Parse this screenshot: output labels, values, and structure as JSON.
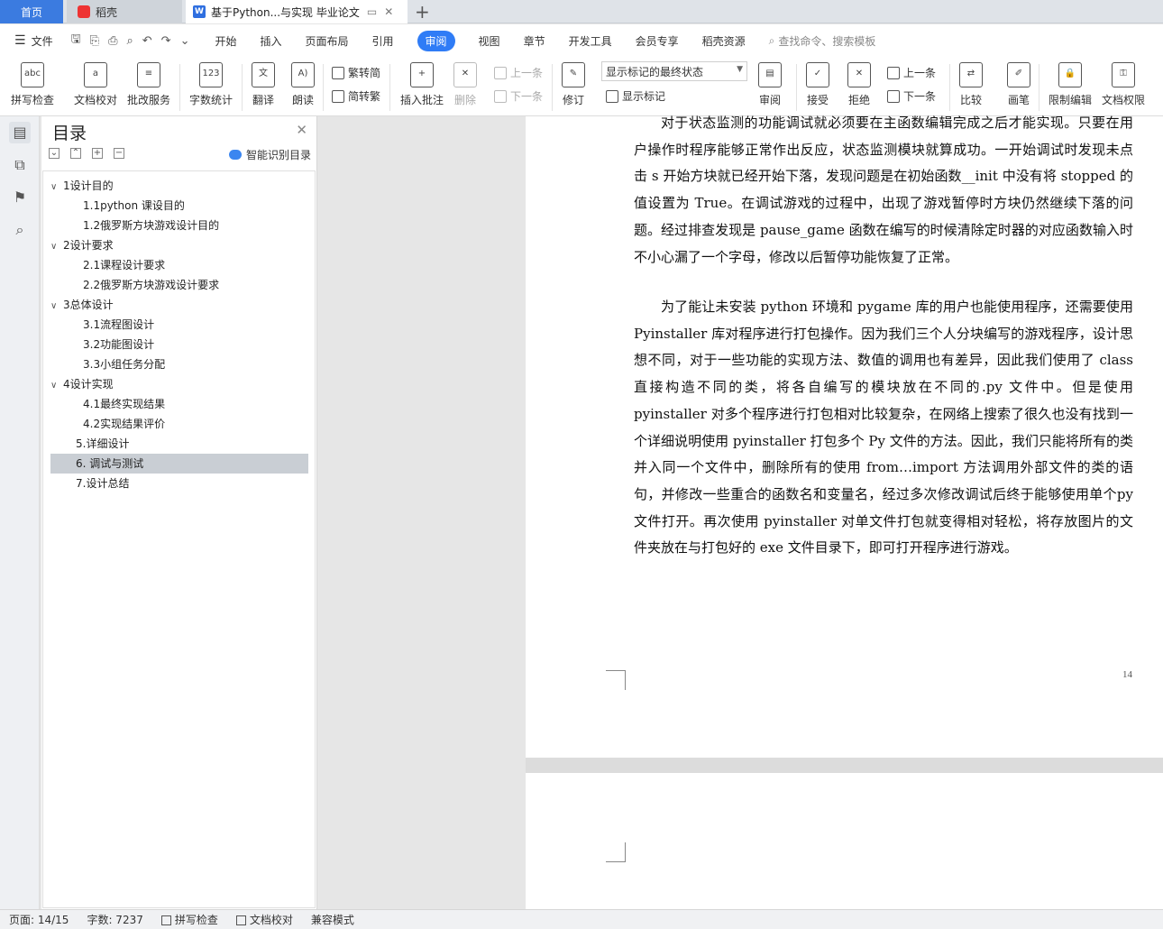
{
  "tabs": {
    "home": "首页",
    "daoke": "稻壳",
    "doc": "基于Python...与实现 毕业论文"
  },
  "menu": {
    "file": "文件",
    "items": [
      "开始",
      "插入",
      "页面布局",
      "引用",
      "审阅",
      "视图",
      "章节",
      "开发工具",
      "会员专享",
      "稻壳资源"
    ],
    "active": "审阅",
    "search_placeholder": "查找命令、搜索模板"
  },
  "ribbon": {
    "spell": "拼写检查",
    "proof": "文档校对",
    "correct": "批改服务",
    "wordcount": "字数统计",
    "translate": "翻译",
    "read": "朗读",
    "t2s": "繁转简",
    "s2t": "简转繁",
    "insert_comment": "插入批注",
    "delete": "删除",
    "prev": "上一条",
    "next": "下一条",
    "revise": "修订",
    "markup_combo": "显示标记的最终状态",
    "show_markup": "显示标记",
    "review": "审阅",
    "accept": "接受",
    "reject": "拒绝",
    "prev2": "上一条",
    "next2": "下一条",
    "compare": "比较",
    "pen": "画笔",
    "restrict": "限制编辑",
    "permission": "文档权限"
  },
  "toc": {
    "title": "目录",
    "smart": "智能识别目录",
    "items": [
      {
        "label": "1设计目的",
        "level": 1,
        "caret": "∨"
      },
      {
        "label": "1.1python 课设目的",
        "level": 2
      },
      {
        "label": "1.2俄罗斯方块游戏设计目的",
        "level": 2
      },
      {
        "label": "2设计要求",
        "level": 1,
        "caret": "∨"
      },
      {
        "label": "2.1课程设计要求",
        "level": 2
      },
      {
        "label": "2.2俄罗斯方块游戏设计要求",
        "level": 2
      },
      {
        "label": "3总体设计",
        "level": 1,
        "caret": "∨"
      },
      {
        "label": "3.1流程图设计",
        "level": 2
      },
      {
        "label": "3.2功能图设计",
        "level": 2
      },
      {
        "label": "3.3小组任务分配",
        "level": 2
      },
      {
        "label": "4设计实现",
        "level": 1,
        "caret": "∨"
      },
      {
        "label": "4.1最终实现结果",
        "level": 2
      },
      {
        "label": "4.2实现结果评价",
        "level": 2
      },
      {
        "label": "5.详细设计",
        "level": 1
      },
      {
        "label": "6. 调试与测试",
        "level": 1,
        "selected": true
      },
      {
        "label": "7.设计总结",
        "level": 1
      }
    ]
  },
  "document": {
    "para1": "对于状态监测的功能调试就必须要在主函数编辑完成之后才能实现。只要在用户操作时程序能够正常作出反应，状态监测模块就算成功。一开始调试时发现未点击 s 开始方块就已经开始下落，发现问题是在初始函数__init 中没有将 stopped 的值设置为 True。在调试游戏的过程中，出现了游戏暂停时方块仍然继续下落的问题。经过排查发现是 pause_game 函数在编写的时候清除定时器的对应函数输入时不小心漏了一个字母，修改以后暂停功能恢复了正常。",
    "para2": "为了能让未安装 python 环境和 pygame 库的用户也能使用程序，还需要使用 Pyinstaller 库对程序进行打包操作。因为我们三个人分块编写的游戏程序，设计思想不同，对于一些功能的实现方法、数值的调用也有差异，因此我们使用了 class  直接构造不同的类，将各自编写的模块放在不同的.py 文件中。但是使用 pyinstaller 对多个程序进行打包相对比较复杂，在网络上搜索了很久也没有找到一个详细说明使用 pyinstaller 打包多个 Py 文件的方法。因此，我们只能将所有的类并入同一个文件中，删除所有的使用 from…import 方法调用外部文件的类的语句，并修改一些重合的函数名和变量名，经过多次修改调试后终于能够使用单个py 文件打开。再次使用 pyinstaller 对单文件打包就变得相对轻松，将存放图片的文件夹放在与打包好的 exe 文件目录下，即可打开程序进行游戏。",
    "page_number": "14"
  },
  "status": {
    "page": "页面: 14/15",
    "words": "字数: 7237",
    "spell": "拼写检查",
    "proof": "文档校对",
    "compat": "兼容模式"
  }
}
